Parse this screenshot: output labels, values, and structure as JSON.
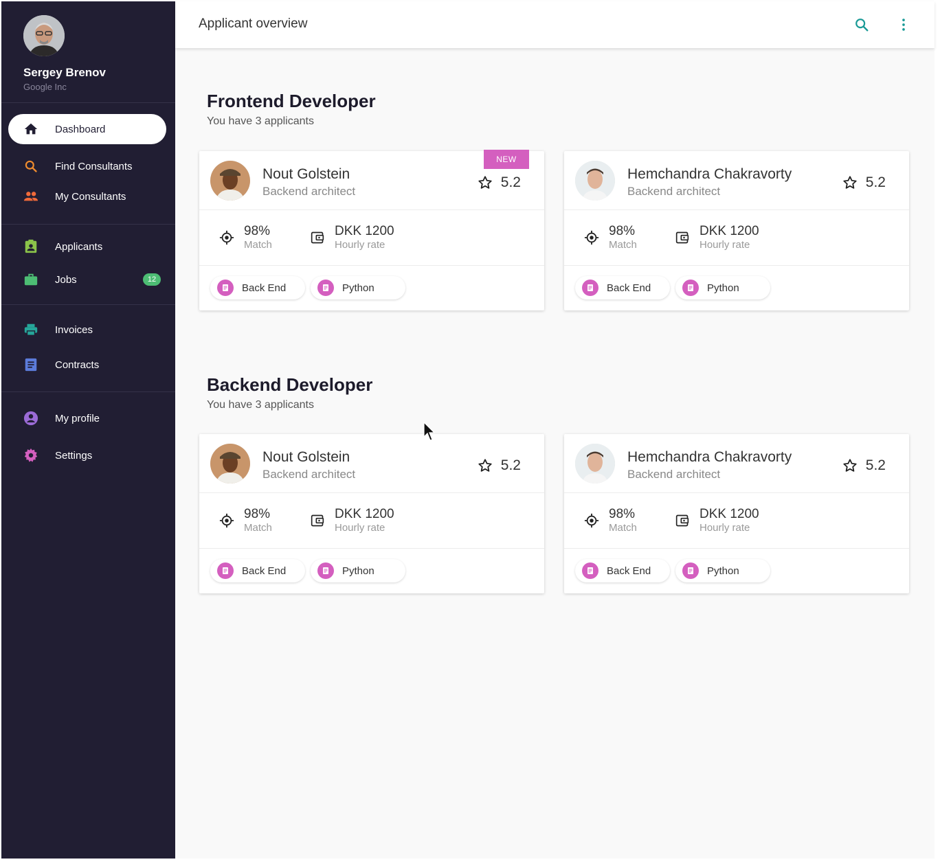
{
  "user": {
    "name": "Sergey Brenov",
    "company": "Google Inc"
  },
  "nav": {
    "dashboard": "Dashboard",
    "find_consultants": "Find Consultants",
    "my_consultants": "My Consultants",
    "applicants": "Applicants",
    "jobs": "Jobs",
    "jobs_badge": "12",
    "invoices": "Invoices",
    "contracts": "Contracts",
    "my_profile": "My profile",
    "settings": "Settings"
  },
  "topbar": {
    "title": "Applicant overview"
  },
  "sections": [
    {
      "title": "Frontend Developer",
      "subtitle": "You have 3 applicants",
      "cards": [
        {
          "name": "Nout Golstein",
          "role": "Backend architect",
          "rating": "5.2",
          "badge": "NEW",
          "match_value": "98%",
          "match_label": "Match",
          "rate_value": "DKK 1200",
          "rate_label": "Hourly rate",
          "tags": [
            "Back End",
            "Python"
          ]
        },
        {
          "name": "Hemchandra Chakravorty",
          "role": "Backend architect",
          "rating": "5.2",
          "match_value": "98%",
          "match_label": "Match",
          "rate_value": "DKK 1200",
          "rate_label": "Hourly rate",
          "tags": [
            "Back End",
            "Python"
          ]
        }
      ]
    },
    {
      "title": "Backend Developer",
      "subtitle": "You have 3 applicants",
      "cards": [
        {
          "name": "Nout Golstein",
          "role": "Backend architect",
          "rating": "5.2",
          "match_value": "98%",
          "match_label": "Match",
          "rate_value": "DKK 1200",
          "rate_label": "Hourly rate",
          "tags": [
            "Back End",
            "Python"
          ]
        },
        {
          "name": "Hemchandra Chakravorty",
          "role": "Backend architect",
          "rating": "5.2",
          "match_value": "98%",
          "match_label": "Match",
          "rate_value": "DKK 1200",
          "rate_label": "Hourly rate",
          "tags": [
            "Back End",
            "Python"
          ]
        }
      ]
    }
  ],
  "icons": {
    "dashboard": "home-icon",
    "find_consultants": "search-icon",
    "my_consultants": "people-icon",
    "applicants": "clipboard-account-icon",
    "jobs": "briefcase-icon",
    "invoices": "printer-icon",
    "contracts": "document-icon",
    "my_profile": "account-circle-icon",
    "settings": "gear-icon",
    "top_search": "search-icon",
    "top_menu": "more-vertical-icon"
  },
  "colors": {
    "sidebar_bg": "#211e33",
    "accent_teal": "#1a9a96",
    "tag_pink": "#d45fbf",
    "badge_green": "#4dbd74",
    "orange": "#f08c2e"
  }
}
